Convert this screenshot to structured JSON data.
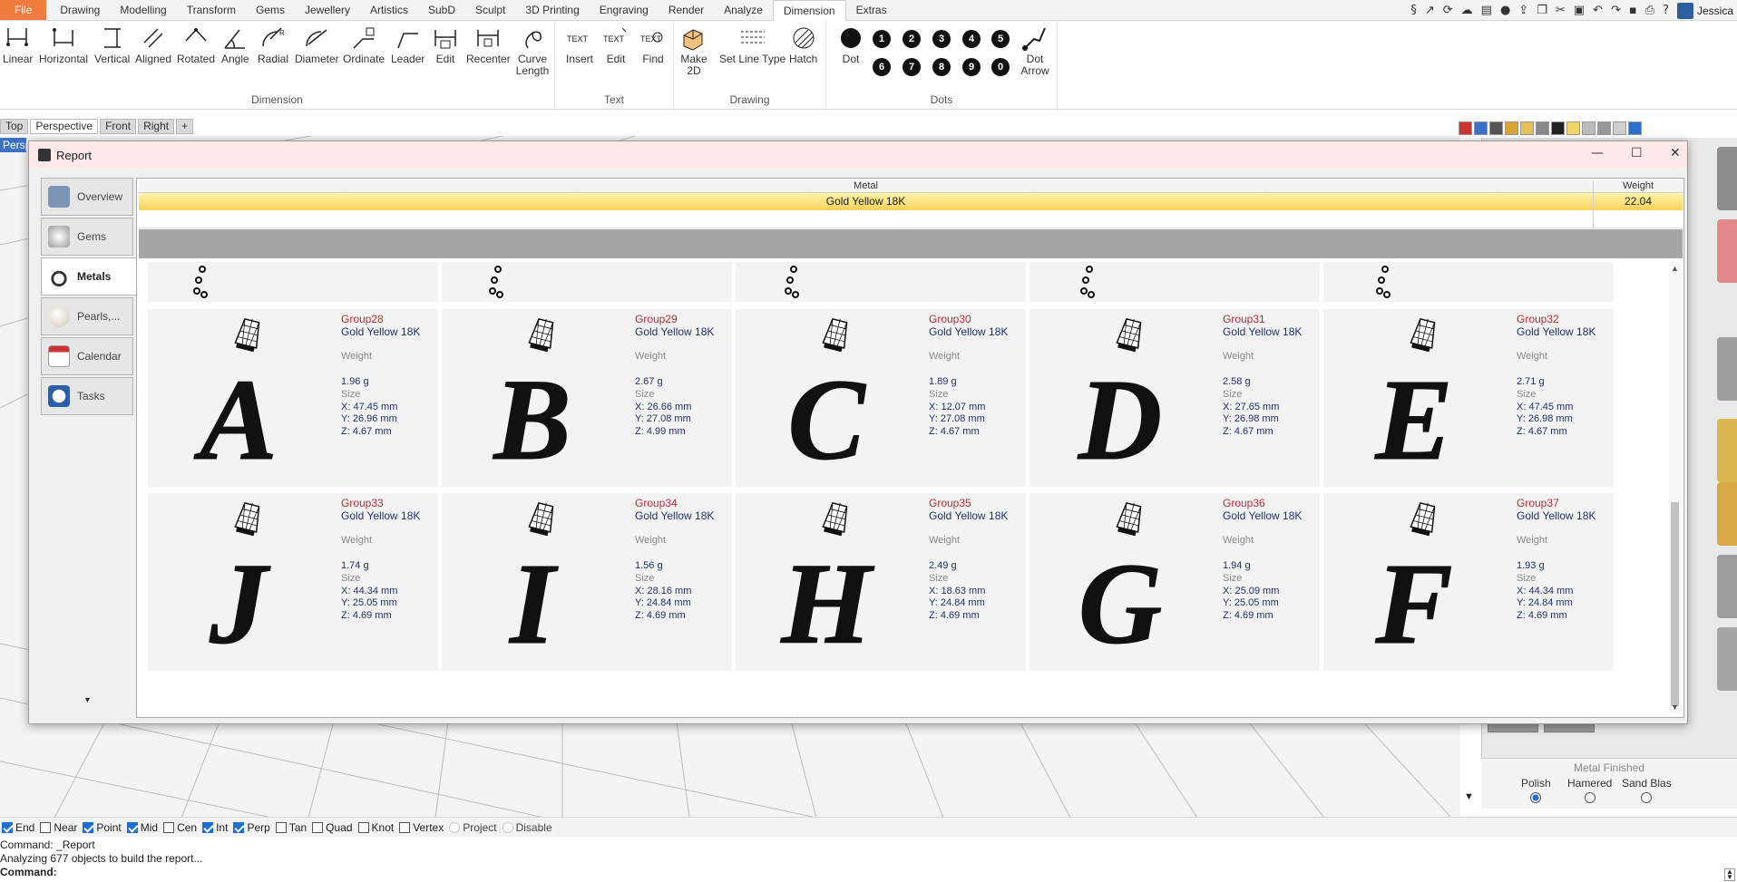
{
  "ribbon": {
    "tabs": [
      "File",
      "Drawing",
      "Modelling",
      "Transform",
      "Gems",
      "Jewellery",
      "Artistics",
      "SubD",
      "Sculpt",
      "3D Printing",
      "Engraving",
      "Render",
      "Analyze",
      "Dimension",
      "Extras"
    ],
    "active_tab": "Dimension",
    "user": "Jessica",
    "groups": {
      "dimension": {
        "name": "Dimension",
        "buttons": [
          "Linear",
          "Horizontal",
          "Vertical",
          "Aligned",
          "Rotated",
          "Angle",
          "Radial",
          "Diameter",
          "Ordinate",
          "Leader",
          "Edit",
          "Recenter",
          "Curve Length"
        ]
      },
      "text": {
        "name": "Text",
        "buttons": [
          "Insert",
          "Edit",
          "Find"
        ],
        "icon_text": "TEXT"
      },
      "drawing": {
        "name": "Drawing",
        "buttons": [
          "Make 2D",
          "Set Line Type",
          "Hatch"
        ]
      },
      "dots": {
        "name": "Dots",
        "dot": "Dot",
        "digits_top": [
          "1",
          "2",
          "3",
          "4",
          "5"
        ],
        "digits_bottom": [
          "6",
          "7",
          "8",
          "9",
          "0"
        ],
        "dot_arrow": "Dot Arrow"
      }
    }
  },
  "viewport": {
    "tabs": [
      "Top",
      "Perspective",
      "Front",
      "Right"
    ],
    "active": "Perspective",
    "label": "Perspective"
  },
  "report": {
    "title": "Report",
    "nav": [
      "Overview",
      "Gems",
      "Metals",
      "Pearls,...",
      "Calendar",
      "Tasks"
    ],
    "active_nav": "Metals",
    "metal_table": {
      "headers": [
        "Metal",
        "Weight"
      ],
      "rows": [
        {
          "metal": "Gold Yellow 18K",
          "weight": "22.04"
        }
      ]
    },
    "labels": {
      "weight": "Weight",
      "size": "Size"
    },
    "cards": [
      {
        "group": "Group28",
        "metal": "Gold Yellow 18K",
        "letter": "A",
        "weight": "1.96 g",
        "x": "X: 47.45 mm",
        "y": "Y: 26.96 mm",
        "z": "Z: 4.67 mm"
      },
      {
        "group": "Group29",
        "metal": "Gold Yellow 18K",
        "letter": "B",
        "weight": "2.67 g",
        "x": "X: 26.66 mm",
        "y": "Y: 27.08 mm",
        "z": "Z: 4.99 mm"
      },
      {
        "group": "Group30",
        "metal": "Gold Yellow 18K",
        "letter": "C",
        "weight": "1.89 g",
        "x": "X: 12.07 mm",
        "y": "Y: 27.08 mm",
        "z": "Z: 4.67 mm"
      },
      {
        "group": "Group31",
        "metal": "Gold Yellow 18K",
        "letter": "D",
        "weight": "2.58 g",
        "x": "X: 27.65 mm",
        "y": "Y: 26.98 mm",
        "z": "Z: 4.67 mm"
      },
      {
        "group": "Group32",
        "metal": "Gold Yellow 18K",
        "letter": "E",
        "weight": "2.71 g",
        "x": "X: 47.45 mm",
        "y": "Y: 26.98 mm",
        "z": "Z: 4.67 mm"
      },
      {
        "group": "Group33",
        "metal": "Gold Yellow 18K",
        "letter": "J",
        "weight": "1.74 g",
        "x": "X: 44.34 mm",
        "y": "Y: 25.05 mm",
        "z": "Z: 4.69 mm"
      },
      {
        "group": "Group34",
        "metal": "Gold Yellow 18K",
        "letter": "I",
        "weight": "1.56 g",
        "x": "X: 28.16 mm",
        "y": "Y: 24.84 mm",
        "z": "Z: 4.69 mm"
      },
      {
        "group": "Group35",
        "metal": "Gold Yellow 18K",
        "letter": "H",
        "weight": "2.49 g",
        "x": "X: 18.63 mm",
        "y": "Y: 24.84 mm",
        "z": "Z: 4.69 mm"
      },
      {
        "group": "Group36",
        "metal": "Gold Yellow 18K",
        "letter": "G",
        "weight": "1.94 g",
        "x": "X: 25.09 mm",
        "y": "Y: 25.05 mm",
        "z": "Z: 4.69 mm"
      },
      {
        "group": "Group37",
        "metal": "Gold Yellow 18K",
        "letter": "F",
        "weight": "1.93 g",
        "x": "X: 44.34 mm",
        "y": "Y: 24.84 mm",
        "z": "Z: 4.69 mm"
      }
    ]
  },
  "metal_finished": {
    "title": "Metal Finished",
    "options": [
      "Polish",
      "Hamered",
      "Sand Blas"
    ],
    "selected": "Polish"
  },
  "osnaps": [
    {
      "label": "End",
      "checked": true
    },
    {
      "label": "Near",
      "checked": false
    },
    {
      "label": "Point",
      "checked": true
    },
    {
      "label": "Mid",
      "checked": true
    },
    {
      "label": "Cen",
      "checked": false
    },
    {
      "label": "Int",
      "checked": true
    },
    {
      "label": "Perp",
      "checked": true
    },
    {
      "label": "Tan",
      "checked": false
    },
    {
      "label": "Quad",
      "checked": false
    },
    {
      "label": "Knot",
      "checked": false
    },
    {
      "label": "Vertex",
      "checked": false
    },
    {
      "label": "Project",
      "checked": false,
      "dim": true
    },
    {
      "label": "Disable",
      "checked": false,
      "dim": true
    }
  ],
  "command": {
    "history": [
      "Command: _Report",
      "Analyzing 677 objects to build the report..."
    ],
    "prompt": "Command:"
  },
  "colors": {
    "file_tab": "#f07b3f",
    "group_name": "#b0303a",
    "selected_row": "#f6d25a",
    "viewport_label": "#3a73c2"
  }
}
